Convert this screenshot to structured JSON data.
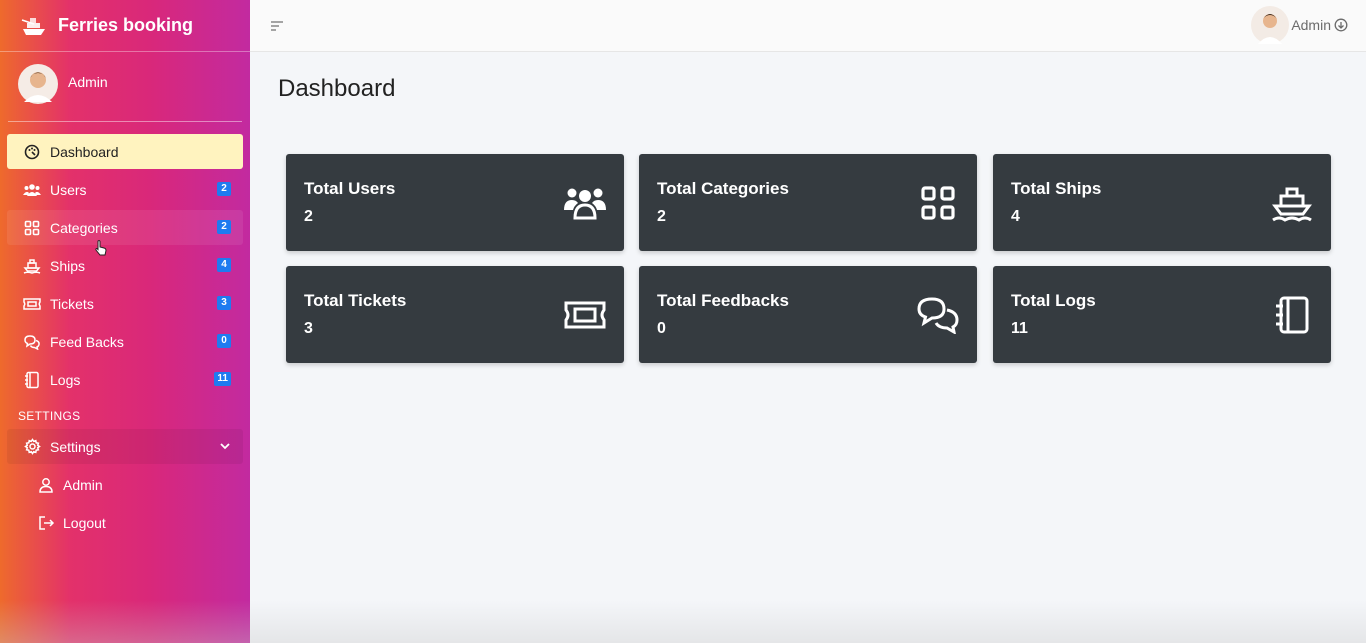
{
  "brand": {
    "name": "Ferries booking",
    "logo_icon": "ship-logo-icon"
  },
  "user_panel": {
    "name": "Admin"
  },
  "sidebar": {
    "items": [
      {
        "label": "Dashboard",
        "icon": "palette-icon",
        "badge": ""
      },
      {
        "label": "Users",
        "icon": "users-icon",
        "badge": "2"
      },
      {
        "label": "Categories",
        "icon": "grid-icon",
        "badge": "2"
      },
      {
        "label": "Ships",
        "icon": "ship-icon",
        "badge": "4"
      },
      {
        "label": "Tickets",
        "icon": "ticket-icon",
        "badge": "3"
      },
      {
        "label": "Feed Backs",
        "icon": "chat-icon",
        "badge": "0"
      },
      {
        "label": "Logs",
        "icon": "notebook-icon",
        "badge": "11"
      }
    ],
    "settings_header": "SETTINGS",
    "settings": {
      "label": "Settings",
      "icon": "gear-icon"
    },
    "sub_items": [
      {
        "label": "Admin",
        "icon": "user-icon"
      },
      {
        "label": "Logout",
        "icon": "logout-icon"
      }
    ]
  },
  "topbar": {
    "user_name": "Admin"
  },
  "main": {
    "title": "Dashboard",
    "cards": [
      {
        "title": "Total Users",
        "value": "2",
        "icon": "users-icon"
      },
      {
        "title": "Total Categories",
        "value": "2",
        "icon": "grid-icon"
      },
      {
        "title": "Total Ships",
        "value": "4",
        "icon": "ship-icon"
      },
      {
        "title": "Total Tickets",
        "value": "3",
        "icon": "ticket-icon"
      },
      {
        "title": "Total Feedbacks",
        "value": "0",
        "icon": "chat-icon"
      },
      {
        "title": "Total Logs",
        "value": "11",
        "icon": "notebook-icon"
      }
    ]
  },
  "colors": {
    "card_bg": "#353b40",
    "active_item_bg": "#fff3bf",
    "badge_bg": "#1e7bf0"
  }
}
